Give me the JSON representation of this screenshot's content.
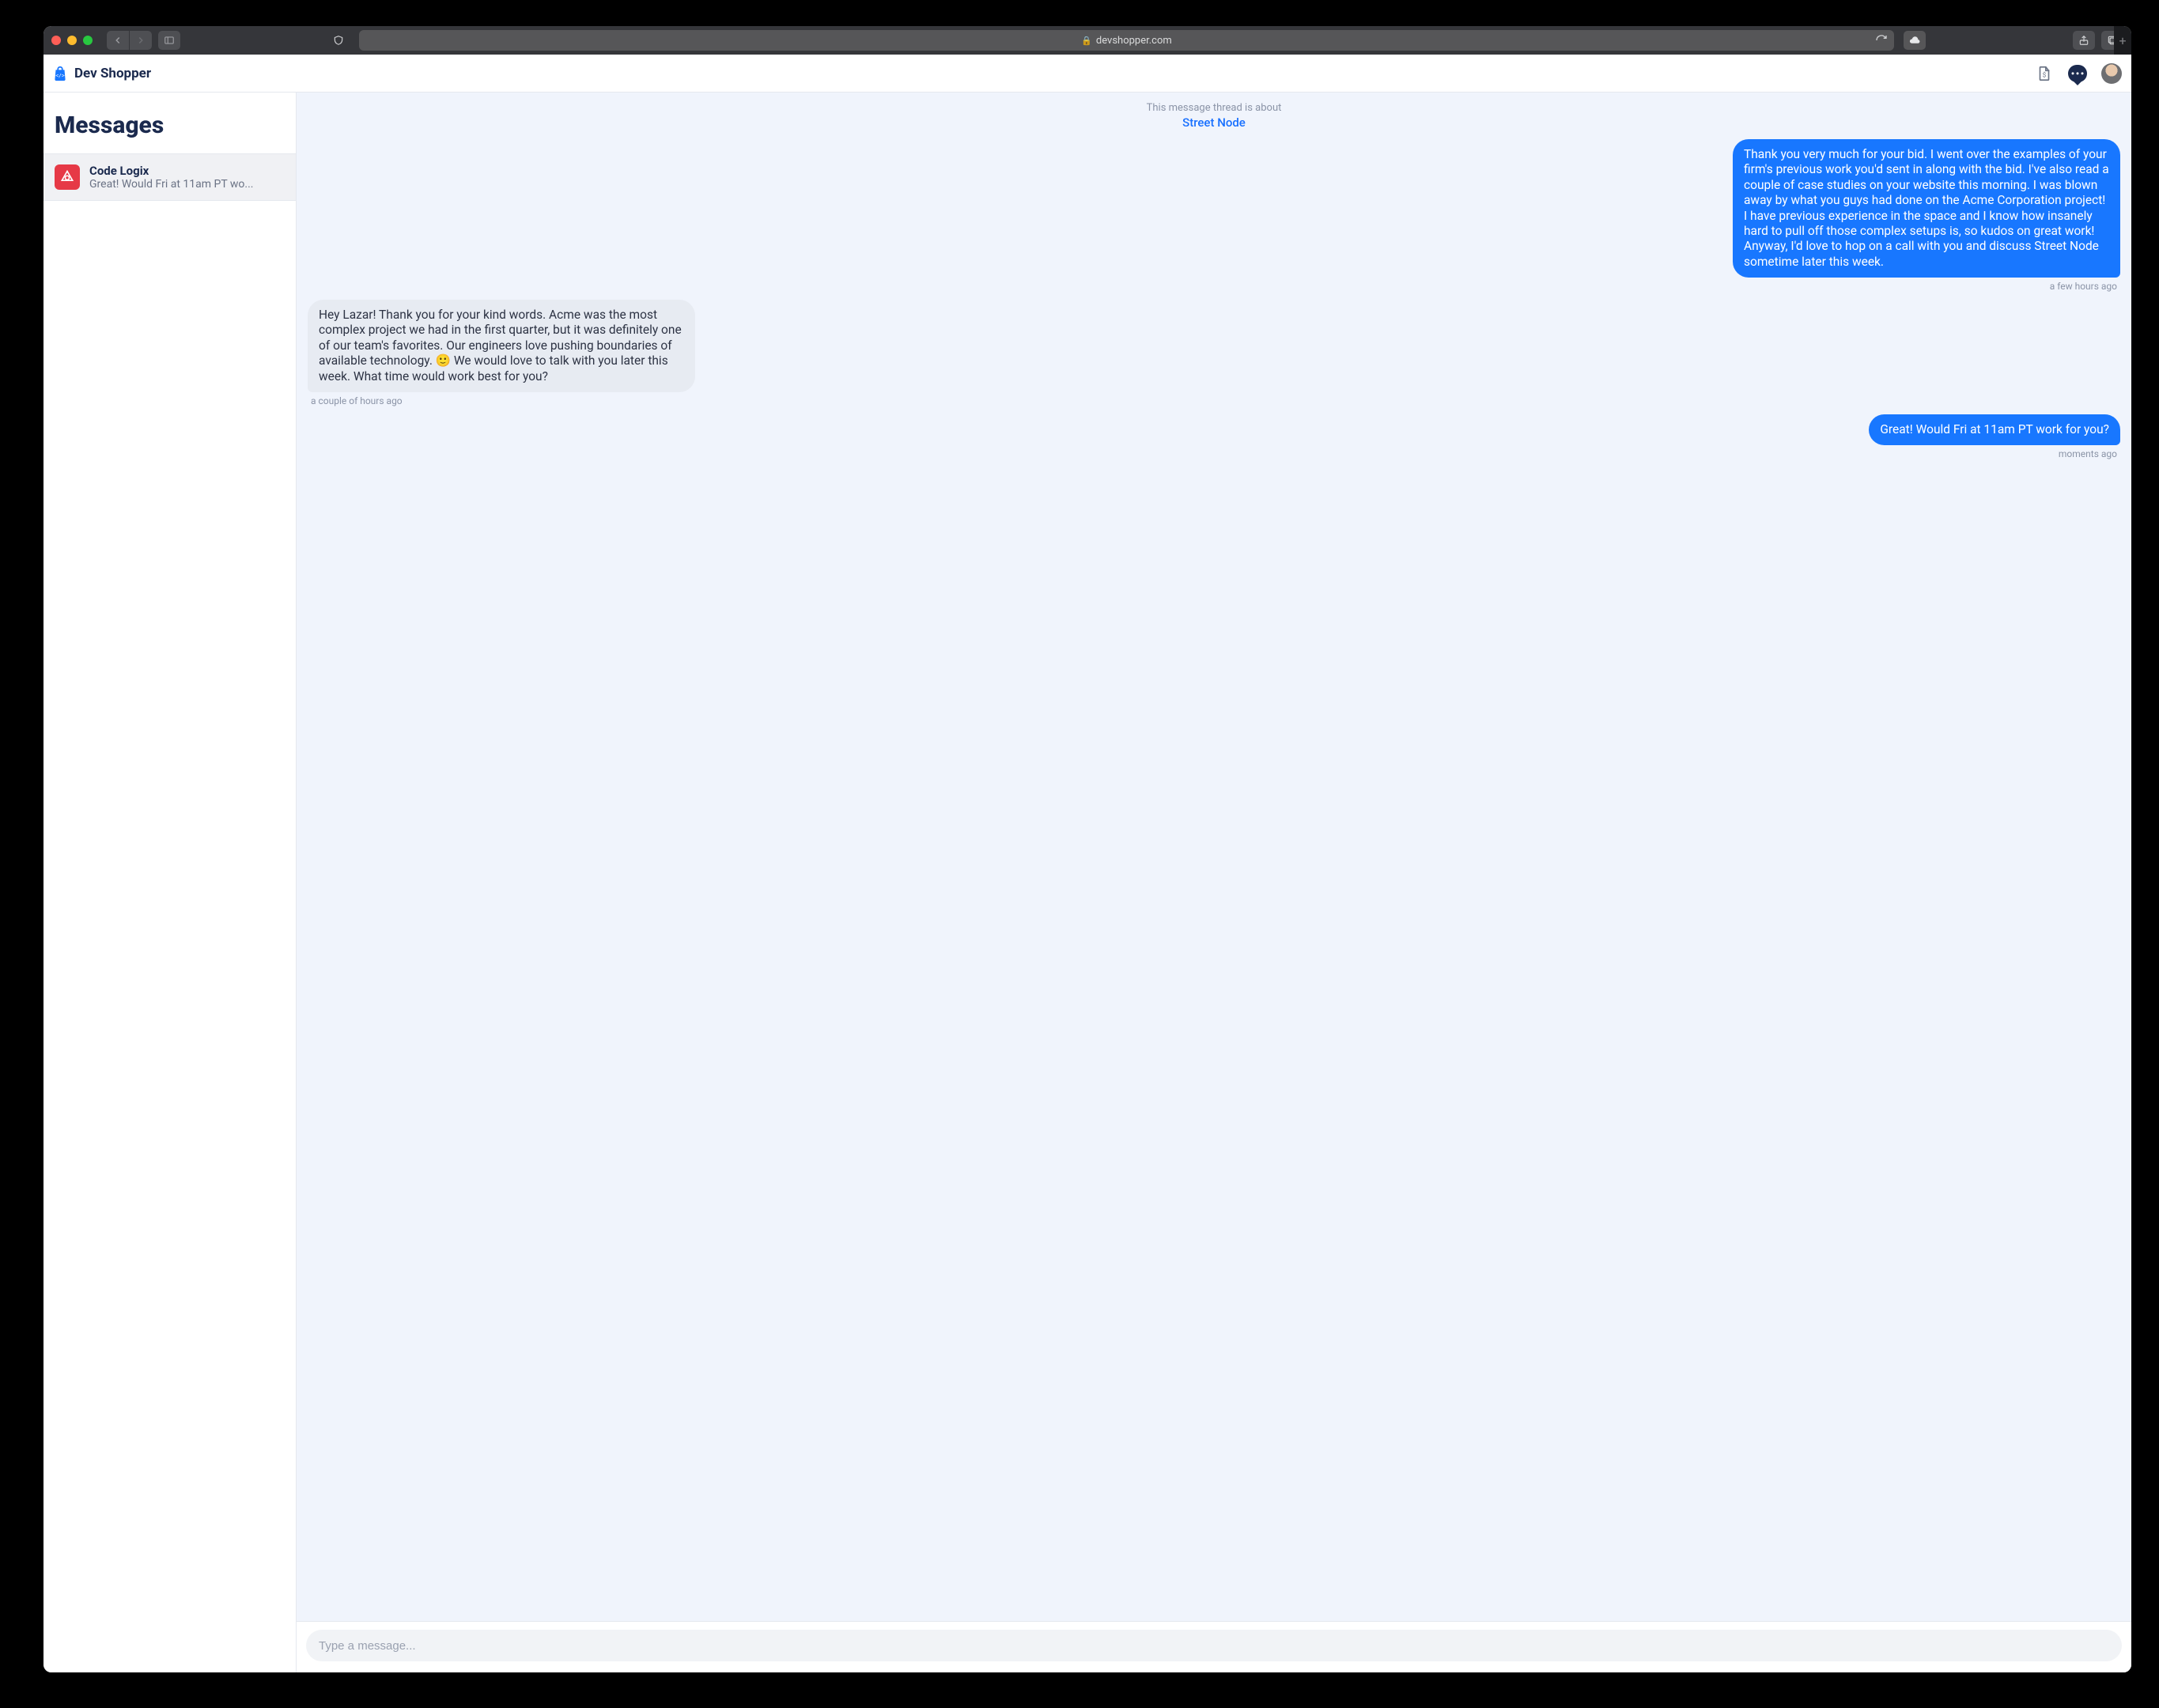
{
  "browser": {
    "url": "devshopper.com"
  },
  "header": {
    "brand": "Dev Shopper"
  },
  "sidebar": {
    "title": "Messages",
    "threads": [
      {
        "name": "Code Logix",
        "preview": "Great! Would Fri at 11am PT wo..."
      }
    ]
  },
  "chat": {
    "thread_header_label": "This message thread is about",
    "thread_topic": "Street Node",
    "messages": [
      {
        "side": "mine",
        "text": "Thank you very much for your bid. I went over the examples of your firm's previous work you'd sent in along with the bid. I've also read a couple of case studies on your website this morning. I was blown away by what you guys had done on the Acme Corporation project! I have previous experience in the space and I know how insanely hard to pull off those complex setups is, so kudos on great work! Anyway, I'd love to hop on a call with you and discuss Street Node sometime later this week.",
        "time": "a few hours ago"
      },
      {
        "side": "theirs",
        "text": "Hey Lazar! Thank you for your kind words. Acme was the most complex project we had in the first quarter, but it was definitely one of our team's favorites. Our engineers love pushing boundaries of available technology. 🙂 We would love to talk with you later this week. What time would work best for you?",
        "time": "a couple of hours ago"
      },
      {
        "side": "mine",
        "text": "Great! Would Fri at 11am PT work for you?",
        "time": "moments ago"
      }
    ],
    "composer_placeholder": "Type a message..."
  }
}
